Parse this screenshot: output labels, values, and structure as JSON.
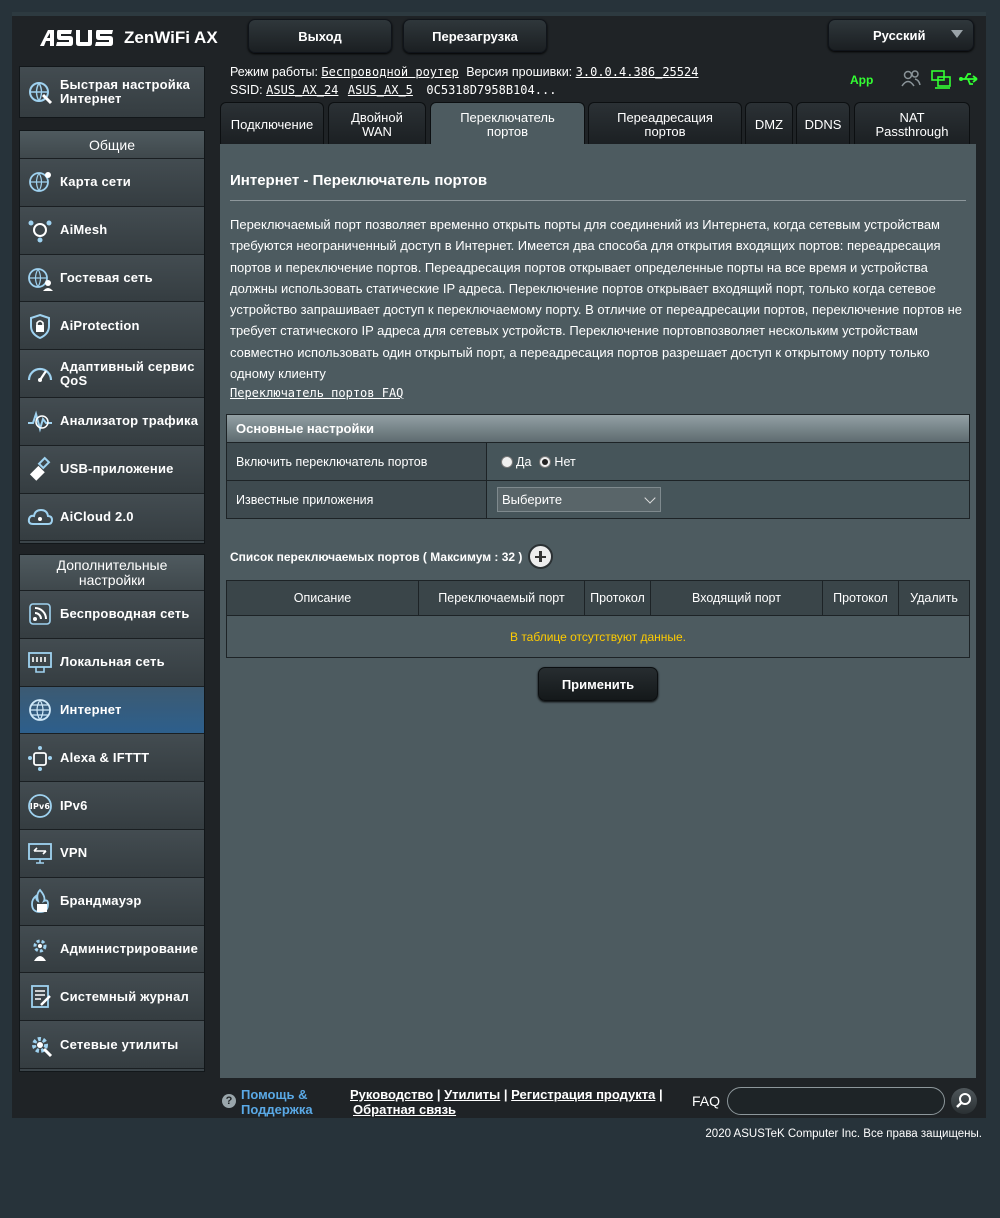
{
  "header": {
    "logo": "/ISUS",
    "model": "ZenWiFi AX",
    "logout_label": "Выход",
    "reboot_label": "Перезагрузка",
    "language": "Русский"
  },
  "sidebar": {
    "quick": "Быстрая настройка Интернет",
    "general_title": "Общие",
    "general": [
      {
        "label": "Карта сети",
        "icon": "globe-map-icon"
      },
      {
        "label": "AiMesh",
        "icon": "aimesh-icon"
      },
      {
        "label": "Гостевая сеть",
        "icon": "guest-network-icon"
      },
      {
        "label": "AiProtection",
        "icon": "shield-lock-icon"
      },
      {
        "label": "Адаптивный сервис QoS",
        "icon": "qos-gauge-icon"
      },
      {
        "label": "Анализатор трафика",
        "icon": "traffic-analyzer-icon"
      },
      {
        "label": "USB-приложение",
        "icon": "usb-icon"
      },
      {
        "label": "AiCloud 2.0",
        "icon": "cloud-icon"
      }
    ],
    "advanced_title": "Дополнительные настройки",
    "advanced": [
      {
        "label": "Беспроводная сеть",
        "icon": "wireless-icon"
      },
      {
        "label": "Локальная сеть",
        "icon": "lan-icon"
      },
      {
        "label": "Интернет",
        "icon": "internet-globe-icon"
      },
      {
        "label": "Alexa & IFTTT",
        "icon": "alexa-icon"
      },
      {
        "label": "IPv6",
        "icon": "ipv6-icon"
      },
      {
        "label": "VPN",
        "icon": "vpn-icon"
      },
      {
        "label": "Брандмауэр",
        "icon": "firewall-icon"
      },
      {
        "label": "Администрирование",
        "icon": "admin-gear-icon"
      },
      {
        "label": "Системный журнал",
        "icon": "system-log-icon"
      },
      {
        "label": "Сетевые утилиты",
        "icon": "network-tools-icon"
      }
    ],
    "active": "Интернет"
  },
  "status": {
    "mode_label": "Режим работы:",
    "mode_value": "Беспроводной роутер",
    "fw_label": "Версия прошивки:",
    "fw_value": "3.0.0.4.386_25524",
    "ssid_label": "SSID:",
    "ssid_24": "ASUS_AX_24",
    "ssid_5": "ASUS_AX_5",
    "mac": "0C5318D7958B104...",
    "app_label": "App",
    "app_color": "#33ff33"
  },
  "tabs": [
    "Подключение",
    "Двойной WAN",
    "Переключатель портов",
    "Переадресация портов",
    "DMZ",
    "DDNS",
    "NAT Passthrough"
  ],
  "active_tab": "Переключатель портов",
  "main": {
    "title": "Интернет - Переключатель портов",
    "description": "Переключаемый порт позволяет временно открыть порты для соединений из Интернета, когда сетевым устройствам требуются неограниченный доступ в Интернет. Имеется два способа для открытия входящих портов: переадресация портов и переключение портов. Переадресация портов открывает определенные порты на все время и устройства должны использовать статические IP адреса. Переключение портов открывает входящий порт, только когда сетевое устройство запрашивает доступ к переключаемому порту. В отличие от переадресации портов, переключение портов не требует статического IP адреса для сетевых устройств. Переключение портовпозволяет нескольким устройствам совместно использовать один открытый порт, а переадресация портов разрешает доступ к открытому порту только одному клиенту",
    "faq_link": "Переключатель портов FAQ",
    "basic_title": "Основные настройки",
    "enable_label": "Включить переключатель портов",
    "yes_label": "Да",
    "no_label": "Нет",
    "enabled": false,
    "known_apps_label": "Известные приложения",
    "known_apps_value": "Выберите",
    "list_title": "Список переключаемых портов ( Максимум : 32 )",
    "columns": [
      "Описание",
      "Переключаемый порт",
      "Протокол",
      "Входящий порт",
      "Протокол",
      "Удалить"
    ],
    "empty_text": "В таблице отсутствуют данные.",
    "empty_color": "#ffcc00",
    "apply_label": "Применить"
  },
  "footer": {
    "help_line1": "Помощь &",
    "help_line2": "Поддержка",
    "link_manual": "Руководство",
    "link_utilities": "Утилиты",
    "link_register": "Регистрация продукта",
    "link_feedback": "Обратная связь",
    "faq_label": "FAQ",
    "copyright": "2020 ASUSTeK Computer Inc. Все права защищены."
  }
}
